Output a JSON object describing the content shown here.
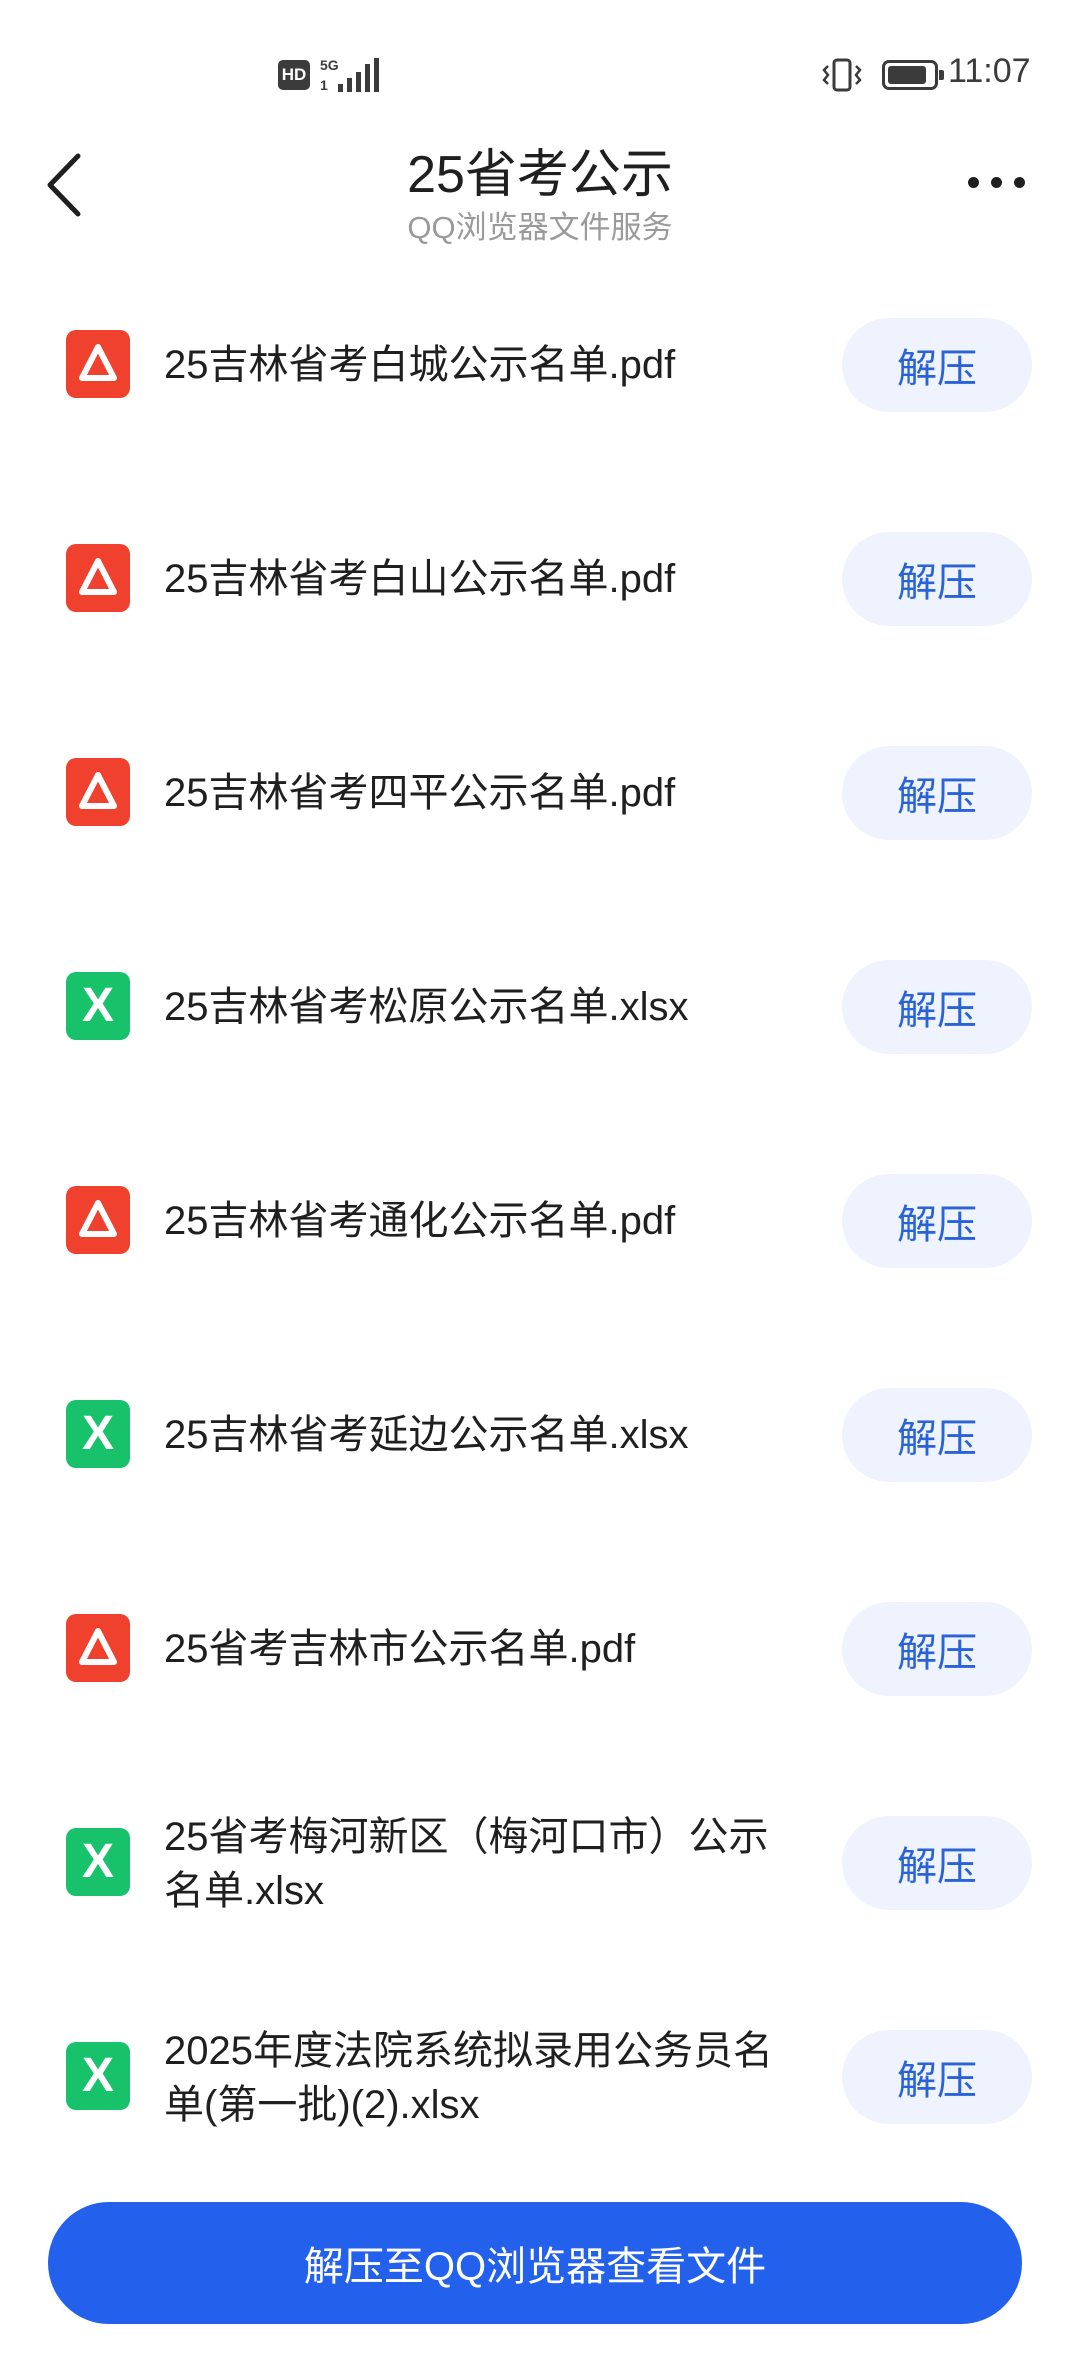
{
  "status_bar": {
    "hd": "HD",
    "network": "5G",
    "time": "11:07"
  },
  "header": {
    "title": "25省考公示",
    "subtitle": "QQ浏览器文件服务",
    "back_icon": "chevron-left-icon",
    "more_icon": "more-dots-icon"
  },
  "files": [
    {
      "name": "25吉林省考白城公示名单.pdf",
      "type": "pdf",
      "action": "解压"
    },
    {
      "name": "25吉林省考白山公示名单.pdf",
      "type": "pdf",
      "action": "解压"
    },
    {
      "name": "25吉林省考四平公示名单.pdf",
      "type": "pdf",
      "action": "解压"
    },
    {
      "name": "25吉林省考松原公示名单.xlsx",
      "type": "xlsx",
      "action": "解压"
    },
    {
      "name": "25吉林省考通化公示名单.pdf",
      "type": "pdf",
      "action": "解压"
    },
    {
      "name": "25吉林省考延边公示名单.xlsx",
      "type": "xlsx",
      "action": "解压"
    },
    {
      "name": "25省考吉林市公示名单.pdf",
      "type": "pdf",
      "action": "解压"
    },
    {
      "name": "25省考梅河新区（梅河口市）公示名单.xlsx",
      "type": "xlsx",
      "action": "解压"
    },
    {
      "name": "2025年度法院系统拟录用公务员名单(第一批)(2).xlsx",
      "type": "xlsx",
      "action": "解压"
    }
  ],
  "footer": {
    "main_button": "解压至QQ浏览器查看文件"
  },
  "colors": {
    "pdf_icon": "#f0402e",
    "xlsx_icon": "#17c26a",
    "button_bg": "#eef3fd",
    "button_text": "#2a62d8",
    "primary": "#2360ec"
  }
}
